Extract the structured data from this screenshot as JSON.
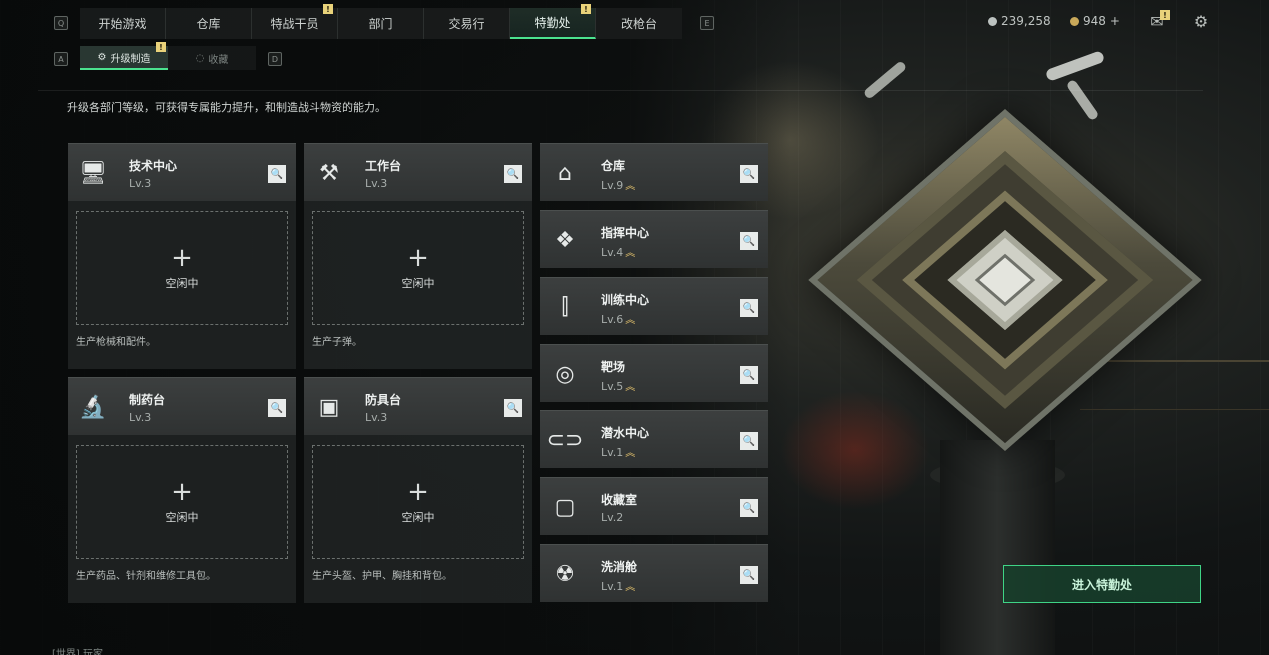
{
  "topnav": {
    "key_left": "Q",
    "key_right": "E",
    "tabs": [
      {
        "label": "开始游戏",
        "badge": ""
      },
      {
        "label": "仓库",
        "badge": ""
      },
      {
        "label": "特战干员",
        "badge": "!"
      },
      {
        "label": "部门",
        "badge": ""
      },
      {
        "label": "交易行",
        "badge": ""
      },
      {
        "label": "特勤处",
        "badge": "!"
      },
      {
        "label": "改枪台",
        "badge": ""
      }
    ]
  },
  "subnav": {
    "key_left": "A",
    "key_right": "D",
    "tabs": [
      {
        "label": "升级制造",
        "badge": "!"
      },
      {
        "label": "收藏",
        "badge": ""
      }
    ]
  },
  "description": "升级各部门等级，可获得专属能力提升，和制造战斗物资的能力。",
  "currency": {
    "coins": "239,258",
    "tokens": "948",
    "tokens_add": "+",
    "mail_badge": "!"
  },
  "workshops": [
    {
      "title": "技术中心",
      "level": "Lv.3",
      "slot_label": "空闲中",
      "slot_plus": "+",
      "footer": "生产枪械和配件。",
      "icon": "computer-icon"
    },
    {
      "title": "工作台",
      "level": "Lv.3",
      "slot_label": "空闲中",
      "slot_plus": "+",
      "footer": "生产子弹。",
      "icon": "tools-icon"
    },
    {
      "title": "制药台",
      "level": "Lv.3",
      "slot_label": "空闲中",
      "slot_plus": "+",
      "footer": "生产药品、针剂和维修工具包。",
      "icon": "microscope-icon"
    },
    {
      "title": "防具台",
      "level": "Lv.3",
      "slot_label": "空闲中",
      "slot_plus": "+",
      "footer": "生产头盔、护甲、胸挂和背包。",
      "icon": "blocks-icon"
    }
  ],
  "facilities": [
    {
      "title": "仓库",
      "level": "Lv.9",
      "upgradable": true,
      "icon": "storage-icon"
    },
    {
      "title": "指挥中心",
      "level": "Lv.4",
      "upgradable": true,
      "icon": "chip-icon"
    },
    {
      "title": "训练中心",
      "level": "Lv.6",
      "upgradable": true,
      "icon": "dumbbell-icon"
    },
    {
      "title": "靶场",
      "level": "Lv.5",
      "upgradable": true,
      "icon": "target-icon"
    },
    {
      "title": "潜水中心",
      "level": "Lv.1",
      "upgradable": true,
      "icon": "goggles-icon"
    },
    {
      "title": "收藏室",
      "level": "Lv.2",
      "upgradable": false,
      "icon": "trophy-icon"
    },
    {
      "title": "洗消舱",
      "level": "Lv.1",
      "upgradable": true,
      "icon": "hazard-icon"
    }
  ],
  "up_glyph": "︽",
  "enter_button": "进入特勤处",
  "chat_line": "[世界] 玩家 ... ",
  "colors": {
    "accent": "#4be38f",
    "badge": "#e9d27a",
    "upgrade": "#e6c46e"
  }
}
